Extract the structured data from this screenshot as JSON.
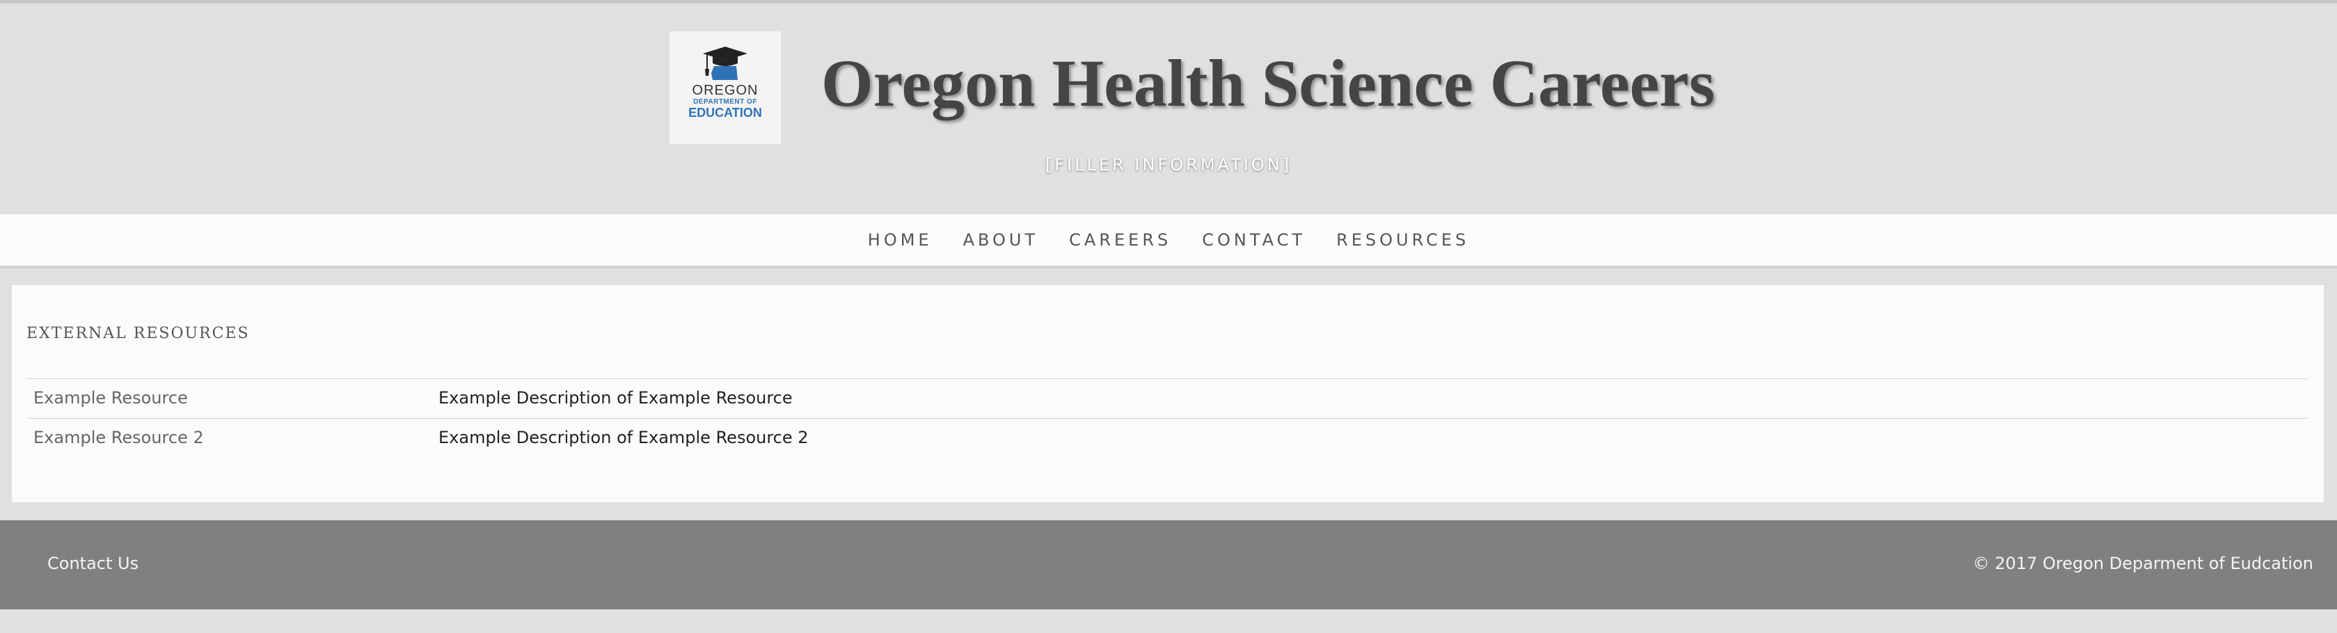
{
  "header": {
    "title": "Oregon Health Science Careers",
    "subtitle": "[FILLER INFORMATION]",
    "logo": {
      "icon": "graduation-cap-oregon-map-icon",
      "line1": "OREGON",
      "line2": "DEPARTMENT OF",
      "line3": "EDUCATION"
    }
  },
  "nav": {
    "items": [
      {
        "label": "HOME"
      },
      {
        "label": "ABOUT"
      },
      {
        "label": "CAREERS"
      },
      {
        "label": "CONTACT"
      },
      {
        "label": "RESOURCES"
      }
    ]
  },
  "main": {
    "section_title": "EXTERNAL RESOURCES",
    "resources": [
      {
        "name": "Example Resource",
        "description": "Example Description of Example Resource"
      },
      {
        "name": "Example Resource 2",
        "description": "Example Description of Example Resource 2"
      }
    ]
  },
  "footer": {
    "contact_label": "Contact Us",
    "copyright": "© 2017 Oregon Deparment of Eudcation"
  },
  "colors": {
    "header_bg": "#e0e0e0",
    "nav_bg": "#fcfcfc",
    "footer_bg": "#808080",
    "logo_blue": "#2f73b6"
  }
}
